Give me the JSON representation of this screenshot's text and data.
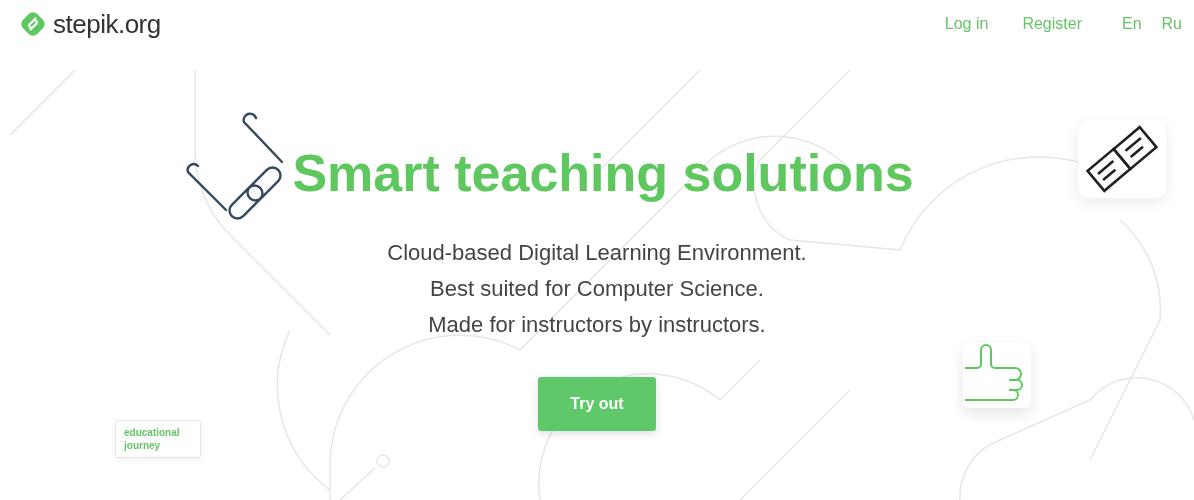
{
  "header": {
    "logo": "stepik.org",
    "nav": [
      {
        "label": "Log in"
      },
      {
        "label": "Register"
      }
    ],
    "languages": [
      {
        "label": "En"
      },
      {
        "label": "Ru"
      }
    ]
  },
  "hero": {
    "title": "Smart teaching solutions",
    "lines": [
      "Cloud-based Digital Learning Environment.",
      "Best suited for Computer Science.",
      "Made for instructors by instructors."
    ],
    "button": "Try out",
    "tag": "educational journey"
  }
}
